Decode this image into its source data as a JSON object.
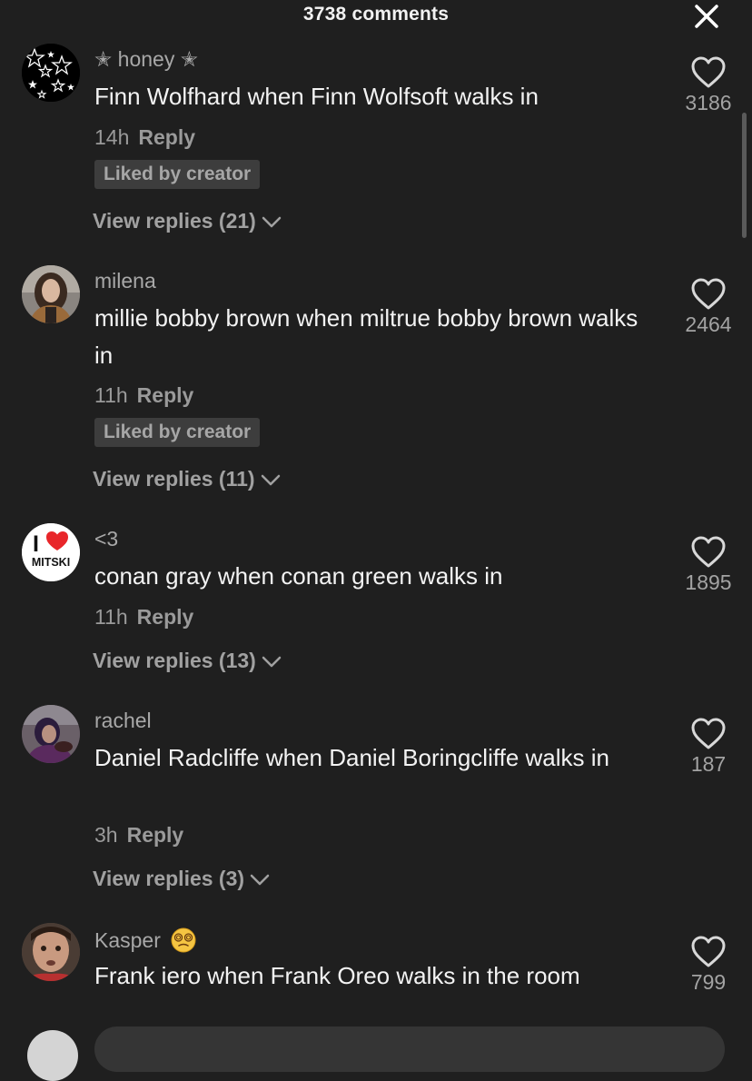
{
  "header": {
    "title": "3738 comments",
    "close_icon": "close-icon"
  },
  "comments": [
    {
      "username": "✭ honey ✭",
      "text": "Finn Wolfhard when Finn Wolfsoft walks in",
      "time": "14h",
      "reply_label": "Reply",
      "liked_by_creator": "Liked by creator",
      "view_replies": "View replies (21)",
      "likes": "3186",
      "avatar": "stars-avatar"
    },
    {
      "username": "milena",
      "text": "millie bobby brown when miltrue bobby brown walks in",
      "time": "11h",
      "reply_label": "Reply",
      "liked_by_creator": "Liked by creator",
      "view_replies": "View replies (11)",
      "likes": "2464",
      "avatar": "photo-avatar"
    },
    {
      "username": "<3",
      "text": "conan gray when conan green walks in",
      "time": "11h",
      "reply_label": "Reply",
      "view_replies": "View replies (13)",
      "likes": "1895",
      "avatar": "i-heart-mitski-avatar",
      "avatar_text": "MITSKI",
      "avatar_i": "I"
    },
    {
      "username": "rachel",
      "text": "Daniel Radcliffe when Daniel Boringcliffe walks in",
      "time": "3h",
      "reply_label": "Reply",
      "view_replies": "View replies (3)",
      "likes": "187",
      "avatar": "photo-avatar"
    },
    {
      "username": "Kasper",
      "text": "Frank iero when Frank Oreo walks in the room",
      "likes": "799",
      "avatar": "photo-avatar",
      "emoji_icon": "dizzy-face-emoji-icon"
    }
  ],
  "colors": {
    "background": "#1f1f1f",
    "heart_red": "#e8262a"
  }
}
